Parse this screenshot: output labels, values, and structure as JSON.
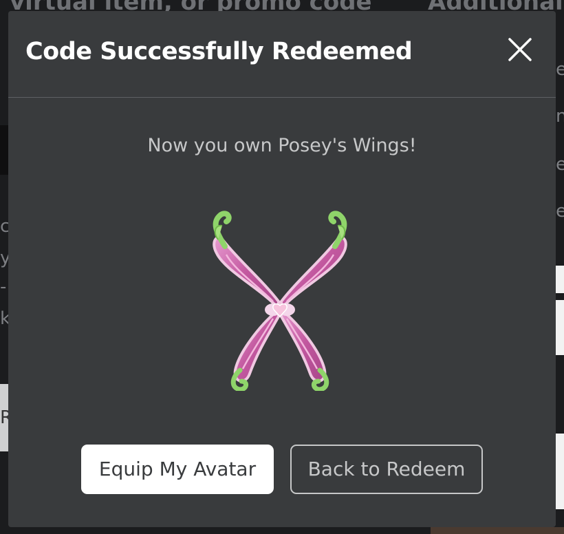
{
  "background": {
    "heading_left": "virtual item, or promo code",
    "heading_right": "Additional",
    "side_letters_left": [
      "c",
      "y",
      "-",
      "k",
      "R"
    ],
    "side_letters_right": [
      "e",
      "n",
      "e",
      "e"
    ]
  },
  "modal": {
    "title": "Code Successfully Redeemed",
    "close_icon": "close-icon",
    "message": "Now you own Posey's Wings!",
    "item_image": "butterfly-wings-item",
    "buttons": {
      "primary": "Equip My Avatar",
      "secondary": "Back to Redeem"
    }
  },
  "colors": {
    "modal_bg": "#393b3d",
    "page_bg": "#1b1c1e",
    "wing_pink": "#c2589f",
    "wing_green": "#8fd46a"
  }
}
